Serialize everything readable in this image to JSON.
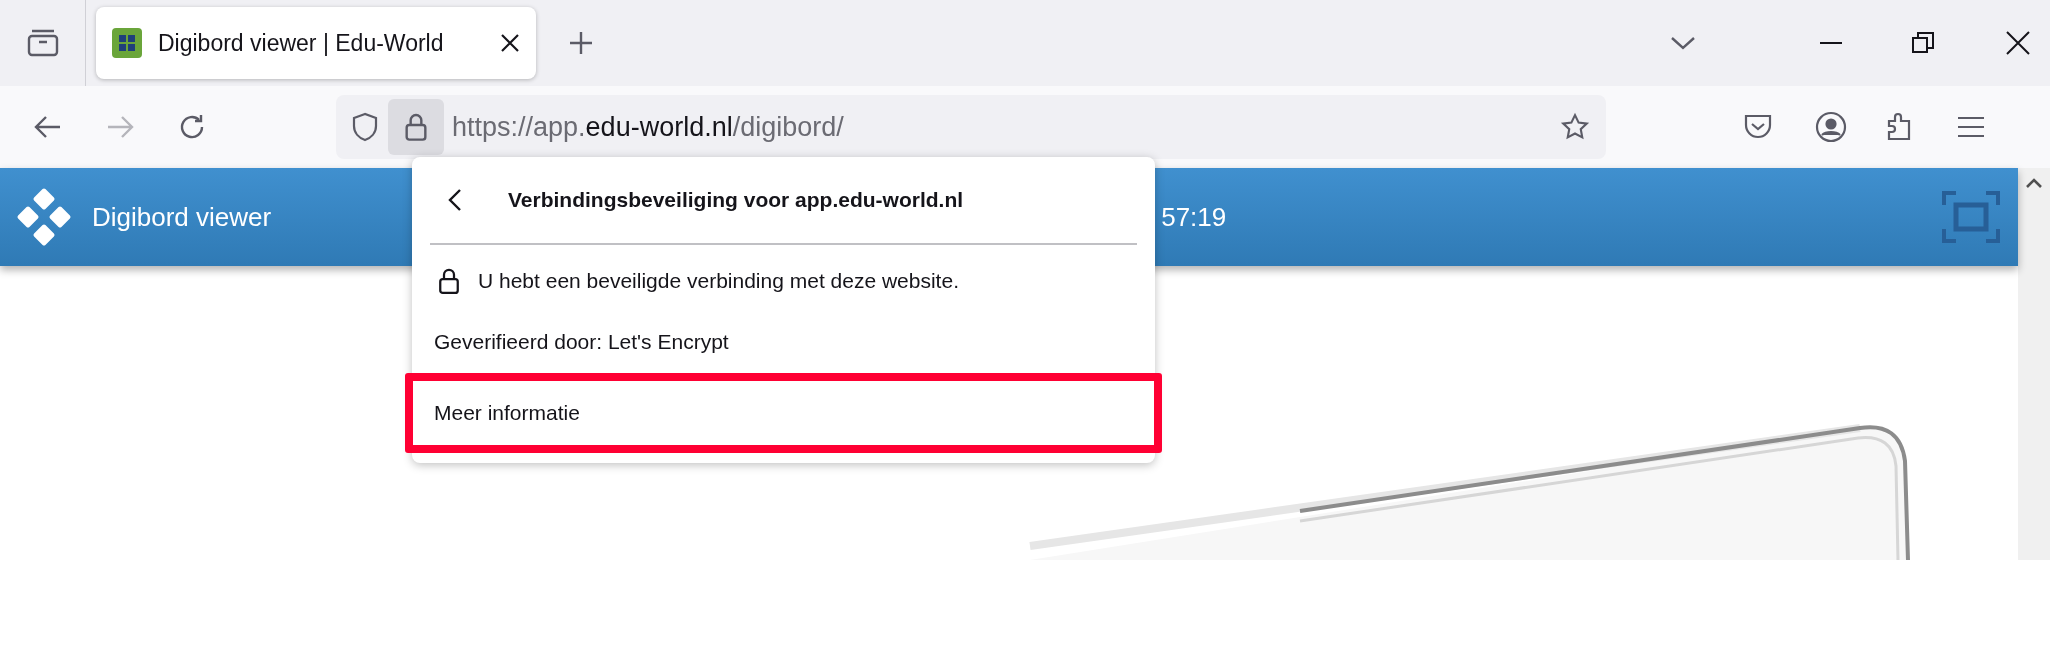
{
  "tabs": [
    {
      "title": "Digibord viewer | Edu-World",
      "selected": true
    }
  ],
  "address_bar": {
    "url_prefix": "https://app.",
    "url_host": "edu-world.nl",
    "url_path": "/digibord/",
    "forward_disabled": true
  },
  "page": {
    "title": "Digibord viewer",
    "clock": "57:19"
  },
  "popup": {
    "title": "Verbindingsbeveiliging voor app.edu-world.nl",
    "items": [
      {
        "kind": "status",
        "text": "U hebt een beveiligde verbinding met deze website.",
        "highlighted": false
      },
      {
        "kind": "info",
        "text": "Geverifieerd door: Let's Encrypt",
        "highlighted": false
      },
      {
        "kind": "link",
        "text": "Meer informatie",
        "highlighted": true
      }
    ]
  }
}
